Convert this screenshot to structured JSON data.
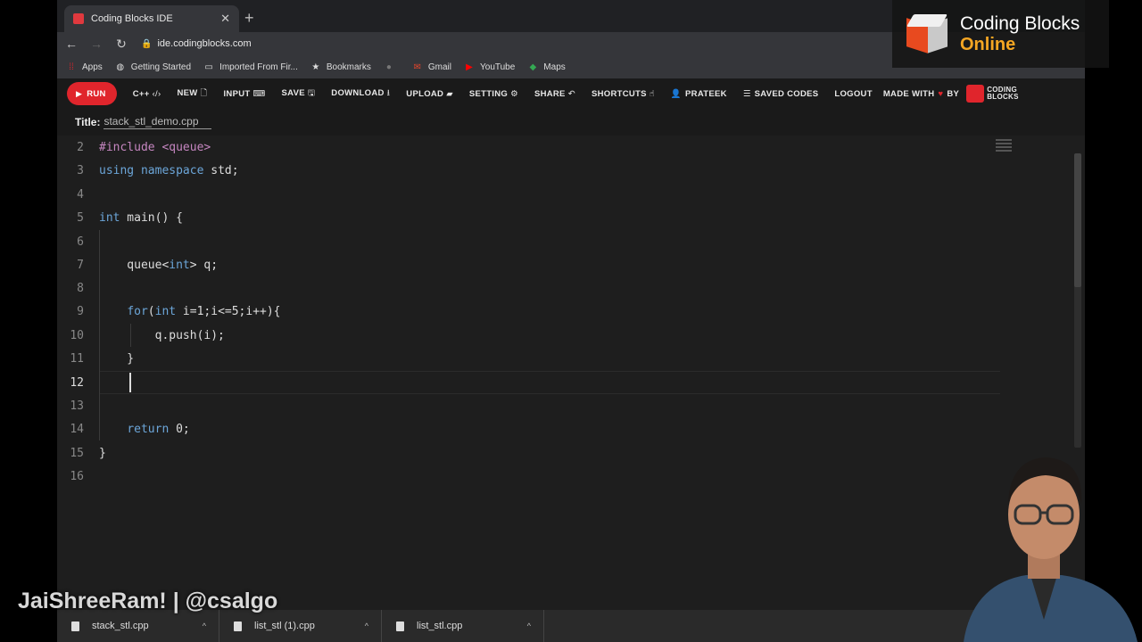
{
  "browser": {
    "tab_title": "Coding Blocks IDE",
    "url": "ide.codingblocks.com",
    "bookmarks": [
      "Apps",
      "Getting Started",
      "Imported From Fir...",
      "Bookmarks",
      "Gmail",
      "YouTube",
      "Maps"
    ]
  },
  "ide": {
    "run_label": "RUN",
    "language": "C++",
    "nav": [
      "NEW",
      "INPUT",
      "SAVE",
      "DOWNLOAD",
      "UPLOAD",
      "SETTING",
      "SHARE",
      "SHORTCUTS",
      "PRATEEK",
      "SAVED CODES",
      "LOGOUT"
    ],
    "made_with": "MADE WITH",
    "by": "BY",
    "logo_line1": "CODING",
    "logo_line2": "BLOCKS",
    "title_label": "Title:",
    "title_value": "stack_stl_demo.cpp"
  },
  "editor": {
    "line_numbers": [
      "2",
      "3",
      "4",
      "5",
      "6",
      "7",
      "8",
      "9",
      "10",
      "11",
      "12",
      "13",
      "14",
      "15",
      "16"
    ],
    "active_line": "12"
  },
  "downloads": [
    "stack_stl.cpp",
    "list_stl (1).cpp",
    "list_stl.cpp"
  ],
  "overlay": {
    "brand_line1": "Coding Blocks",
    "brand_line2": "Online",
    "handle": "JaiShreeRam! | @csalgo"
  },
  "colors": {
    "accent": "#e0252c",
    "brand_orange": "#f5a623"
  }
}
